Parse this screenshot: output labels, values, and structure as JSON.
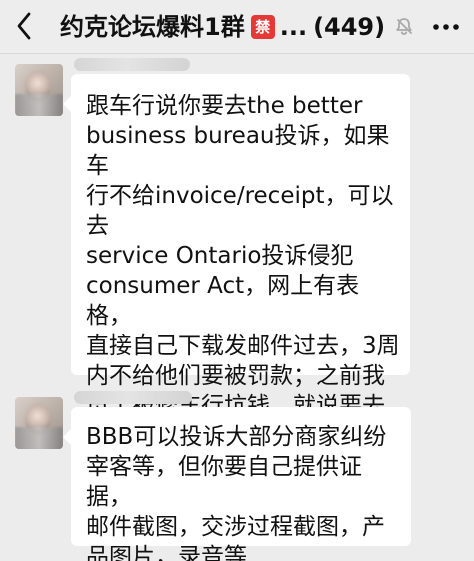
{
  "header": {
    "title_prefix": "约克论坛爆料1群",
    "badge": "禁",
    "title_suffix": "...",
    "member_count": "(449)"
  },
  "icons": {
    "back": "back-arrow-icon",
    "mute": "mute-bell-icon",
    "more": "more-icon"
  },
  "messages": [
    {
      "text": "跟车行说你要去the better\nbusiness bureau投诉，如果车\n行不给invoice/receipt，可以去\nservice Ontario投诉侵犯\nconsumer Act，网上有表格，\n直接自己下载发邮件过去，3周\n内不给他们要被罚款；之前我\n员工被修车行坑钱，就说要去\nBBB上投诉，退了款，只收了\n正常的人工，你可以试试"
    },
    {
      "text": "BBB可以投诉大部分商家纠纷\n宰客等，但你要自己提供证据，\n邮件截图，交涉过程截图，产\n品图片，录音等"
    }
  ]
}
